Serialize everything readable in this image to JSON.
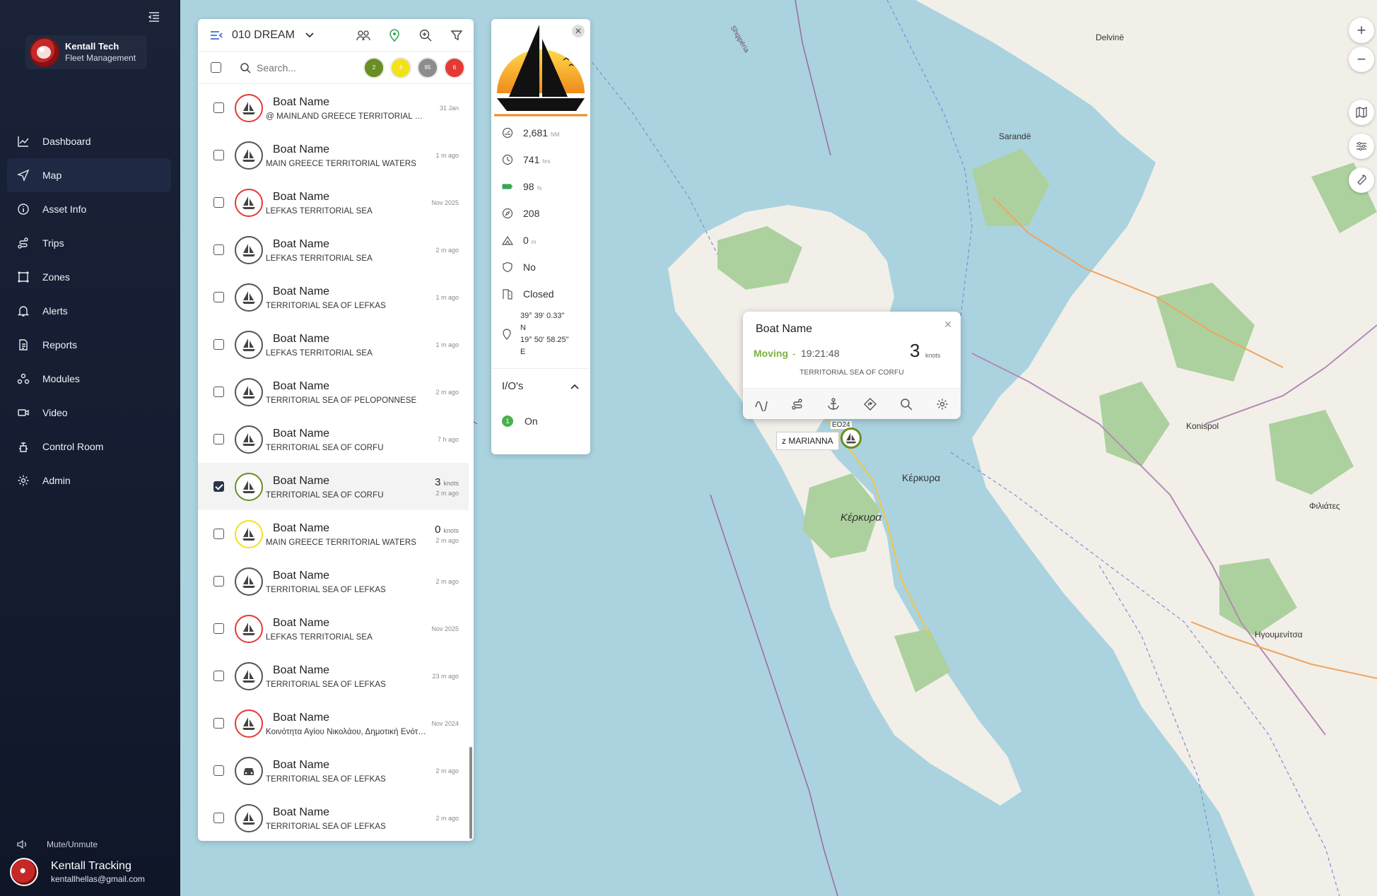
{
  "app": {
    "brand_title": "Kentall Tech",
    "brand_subtitle": "Fleet Management"
  },
  "sidebar": {
    "items": [
      {
        "label": "Dashboard",
        "icon": "chart-line-icon"
      },
      {
        "label": "Map",
        "icon": "navigation-arrow-icon",
        "active": true
      },
      {
        "label": "Asset Info",
        "icon": "info-circle-icon"
      },
      {
        "label": "Trips",
        "icon": "route-icon"
      },
      {
        "label": "Zones",
        "icon": "zone-polygon-icon"
      },
      {
        "label": "Alerts",
        "icon": "bell-icon"
      },
      {
        "label": "Reports",
        "icon": "document-icon"
      },
      {
        "label": "Modules",
        "icon": "modules-icon"
      },
      {
        "label": "Video",
        "icon": "video-camera-icon"
      },
      {
        "label": "Control Room",
        "icon": "control-room-icon"
      },
      {
        "label": "Admin",
        "icon": "gear-icon"
      }
    ],
    "mute_label": "Mute/Unmute",
    "user_name": "Kentall Tracking",
    "user_email": "kentallhellas@gmail.com"
  },
  "list_panel": {
    "fleet_name": "010 DREAM",
    "search_placeholder": "Search...",
    "badges": [
      {
        "count": "2",
        "color": "#6b8e23"
      },
      {
        "count": "4",
        "color": "#f2e21c"
      },
      {
        "count": "95",
        "color": "#8d8d8d"
      },
      {
        "count": "6",
        "color": "#e53935"
      }
    ],
    "rows": [
      {
        "name": "Boat Name",
        "location": "@ MAINLAND GREECE TERRITORIAL WATERS",
        "time": "31 Jan",
        "status": "red"
      },
      {
        "name": "Boat Name",
        "location": "MAIN GREECE TERRITORIAL WATERS",
        "time": "1 m ago",
        "status": "grey"
      },
      {
        "name": "Boat Name",
        "location": "LEFKAS TERRITORIAL SEA",
        "time": "Nov 2025",
        "status": "red"
      },
      {
        "name": "Boat Name",
        "location": "LEFKAS TERRITORIAL SEA",
        "time": "2 m ago",
        "status": "grey"
      },
      {
        "name": "Boat Name",
        "location": "TERRITORIAL SEA OF LEFKAS",
        "time": "1 m ago",
        "status": "grey"
      },
      {
        "name": "Boat Name",
        "location": "LEFKAS TERRITORIAL SEA",
        "time": "1 m ago",
        "status": "grey"
      },
      {
        "name": "Boat Name",
        "location": "TERRITORIAL SEA OF PELOPONNESE",
        "time": "2 m ago",
        "status": "grey"
      },
      {
        "name": "Boat Name",
        "location": "TERRITORIAL SEA OF CORFU",
        "time": "7 h ago",
        "status": "grey"
      },
      {
        "name": "Boat Name",
        "location": "TERRITORIAL SEA OF CORFU",
        "time": "2 m ago",
        "speed": "3",
        "unit": "knots",
        "status": "green",
        "selected": true
      },
      {
        "name": "Boat Name",
        "location": "MAIN GREECE TERRITORIAL WATERS",
        "time": "2 m ago",
        "speed": "0",
        "unit": "knots",
        "status": "yellow"
      },
      {
        "name": "Boat Name",
        "location": "TERRITORIAL SEA OF LEFKAS",
        "time": "2 m ago",
        "status": "grey"
      },
      {
        "name": "Boat Name",
        "location": "LEFKAS TERRITORIAL SEA",
        "time": "Nov 2025",
        "status": "red"
      },
      {
        "name": "Boat Name",
        "location": "TERRITORIAL SEA OF LEFKAS",
        "time": "23 m ago",
        "status": "grey"
      },
      {
        "name": "Boat Name",
        "location": "Κοινότητα Αγίου Νικολάου, Δημοτική Ενότητα",
        "time": "Nov 2024",
        "status": "red"
      },
      {
        "name": "Boat Name",
        "location": "TERRITORIAL SEA OF LEFKAS",
        "time": "2 m ago",
        "status": "grey",
        "icon": "car"
      },
      {
        "name": "Boat Name",
        "location": "TERRITORIAL SEA OF LEFKAS",
        "time": "2 m ago",
        "status": "grey"
      }
    ]
  },
  "detail_panel": {
    "stats": [
      {
        "icon": "odometer-icon",
        "value": "2,681",
        "unit": "NM"
      },
      {
        "icon": "clock-icon",
        "value": "741",
        "unit": "hrs"
      },
      {
        "icon": "battery-icon",
        "value": "98",
        "unit": "%"
      },
      {
        "icon": "compass-icon",
        "value": "208",
        "unit": ""
      },
      {
        "icon": "altitude-icon",
        "value": "0",
        "unit": "m"
      },
      {
        "icon": "shield-icon",
        "value": "No",
        "unit": ""
      },
      {
        "icon": "door-icon",
        "value": "Closed",
        "unit": ""
      }
    ],
    "coord_lat": "39° 39' 0.33\"",
    "coord_lat_dir": "N",
    "coord_lon": "19° 50' 58.25\"",
    "coord_lon_dir": "E",
    "io_title": "I/O's",
    "io_items": [
      {
        "index": "1",
        "label": "On"
      }
    ]
  },
  "popup": {
    "name": "Boat Name",
    "status": "Moving",
    "separator": "-",
    "time": "19:21:48",
    "speed": "3",
    "unit": "knots",
    "location": "TERRITORIAL SEA OF CORFU"
  },
  "map": {
    "marker_label": "z MARIANNA",
    "labels": [
      "Delvinë",
      "Sarandë",
      "Konispol",
      "Κέρκυρα",
      "Κέρκυρα",
      "Φιλιάτες",
      "Ηγουμενίτσα",
      "EO24",
      "Shqipëria"
    ],
    "zoom_in": "+",
    "zoom_out": "−"
  },
  "colors": {
    "sea": "#aad3df",
    "land": "#f2efe9",
    "forest": "#add19e",
    "sidebar": "#161e33"
  }
}
